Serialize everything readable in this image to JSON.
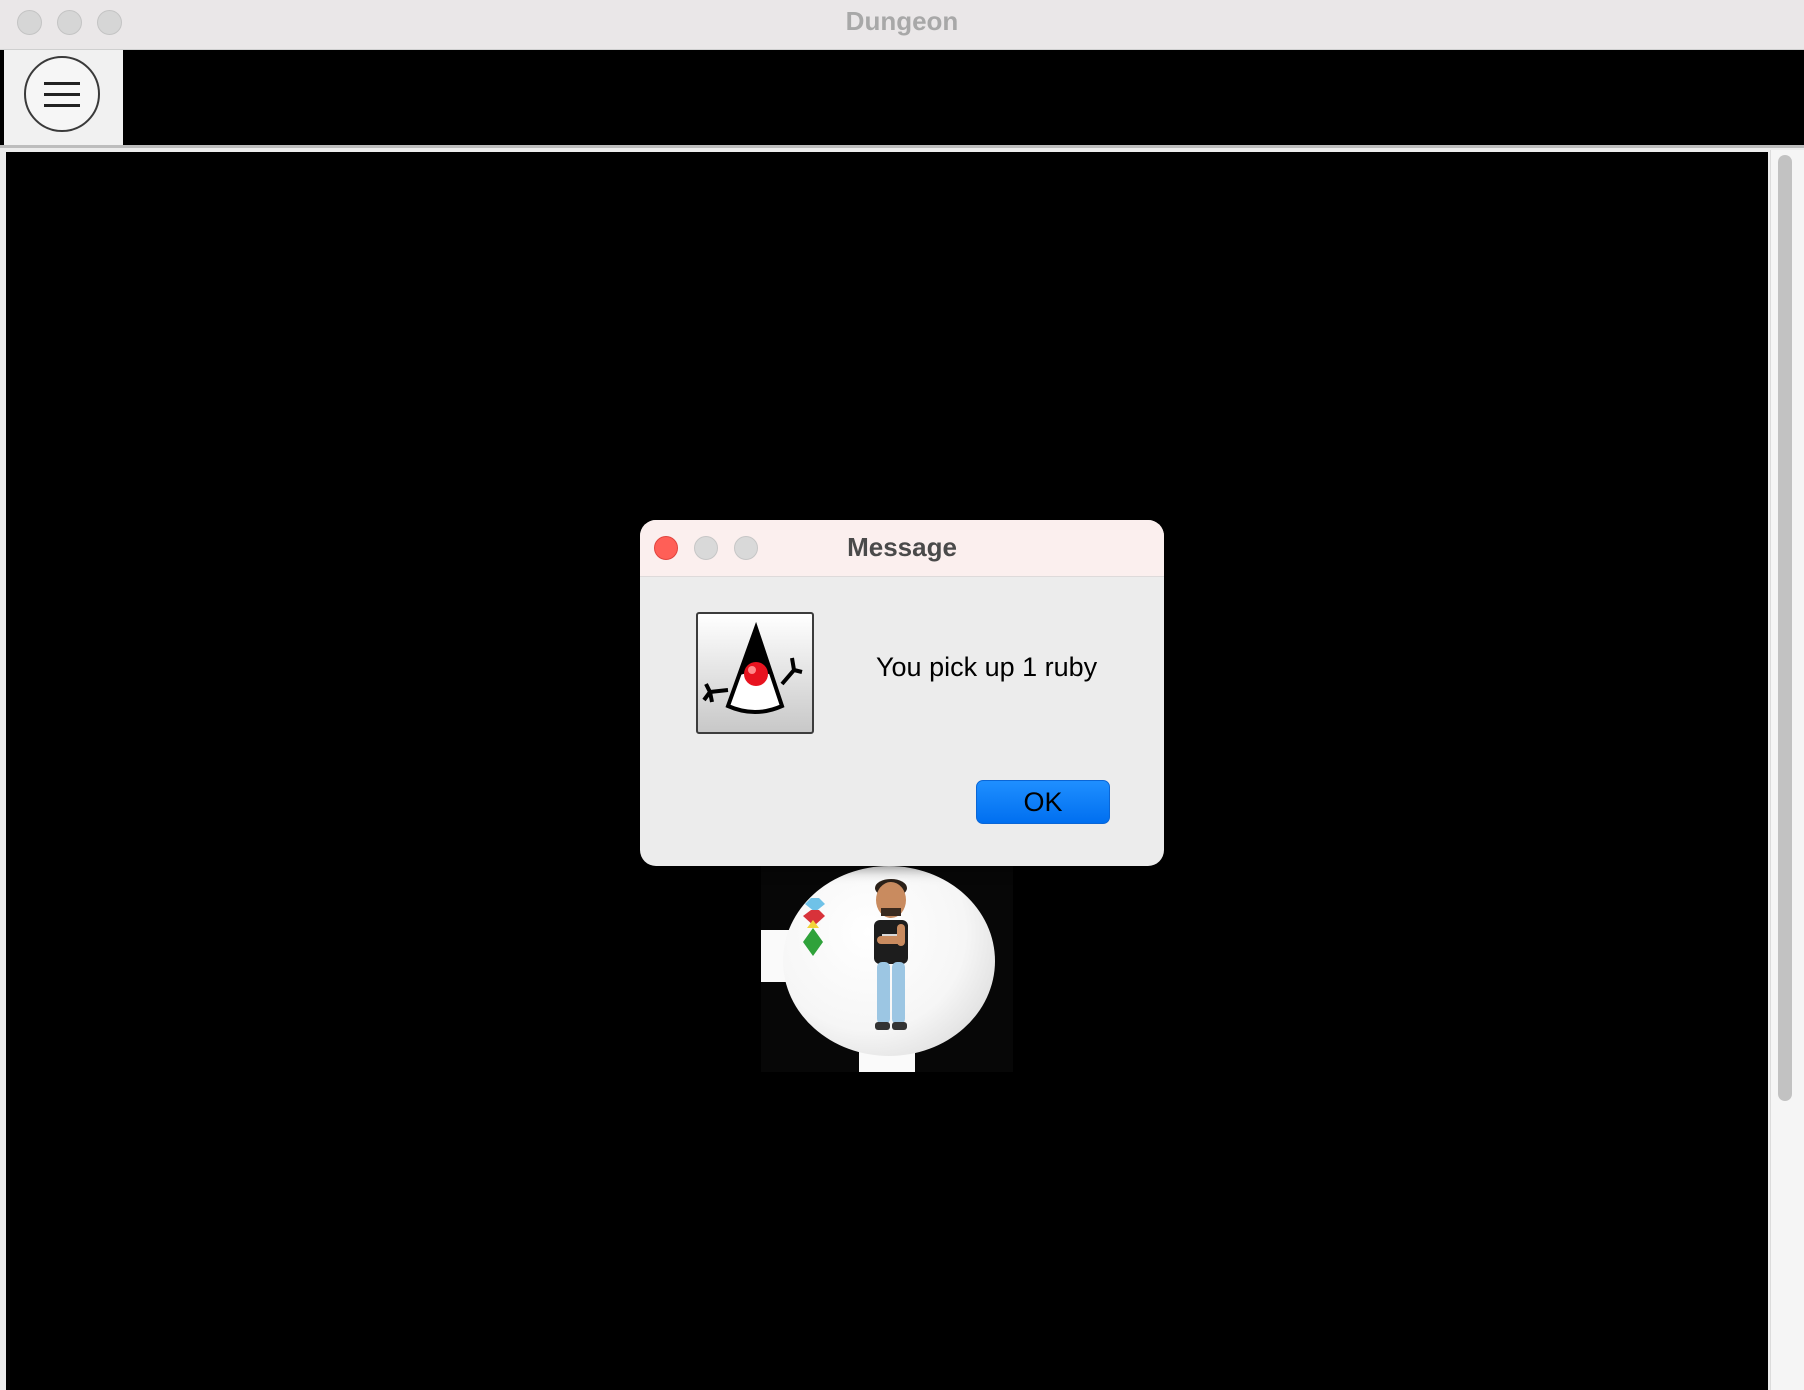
{
  "window": {
    "title": "Dungeon",
    "traffic_lights": [
      "close-button",
      "minimize-button",
      "zoom-button"
    ]
  },
  "toolbar": {
    "menu_icon": "hamburger-menu-icon"
  },
  "game": {
    "player_icon": "player-avatar",
    "item_icon": "gem-icon",
    "colors": {
      "background": "#000000",
      "room": "#ffffff"
    }
  },
  "dialog": {
    "title": "Message",
    "icon": "java-duke-icon",
    "message": "You pick up 1 ruby",
    "ok_label": "OK",
    "colors": {
      "ok_button": "#0a84ff",
      "close_light": "#ff5f57"
    }
  }
}
